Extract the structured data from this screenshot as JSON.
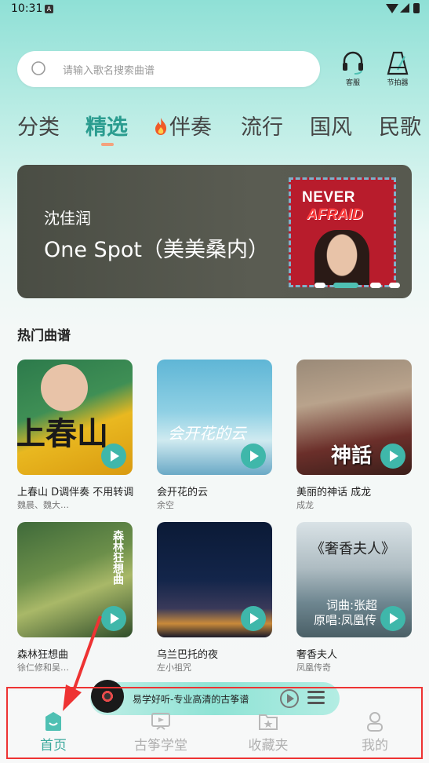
{
  "status_bar": {
    "time": "10:31",
    "sim_icon": "A"
  },
  "search": {
    "placeholder": "请输入歌名搜索曲谱"
  },
  "top_buttons": {
    "service": "客服",
    "metronome": "节拍器"
  },
  "tabs": [
    {
      "label": "分类"
    },
    {
      "label": "精选",
      "active": true
    },
    {
      "label": "伴奏",
      "icon": "fire-icon"
    },
    {
      "label": "流行"
    },
    {
      "label": "国风"
    },
    {
      "label": "民歌"
    }
  ],
  "banner": {
    "artist": "沈佳润",
    "song": "One Spot（美美桑内）",
    "cover_title_1": "NEVER",
    "cover_title_2": "AFRAID",
    "slides_total": 4,
    "slide_active_index": 1
  },
  "hot": {
    "title": "热门曲谱",
    "cards": [
      {
        "name": "上春山 D调伴奏 不用转调",
        "sub": "魏晨、魏大…",
        "overlay": "上春山"
      },
      {
        "name": "会开花的云",
        "sub": "余空",
        "overlay": "会开花的云"
      },
      {
        "name": "美丽的神话 成龙",
        "sub": "成龙",
        "overlay": "神話"
      },
      {
        "name": "森林狂想曲",
        "sub": "徐仁修和吴…",
        "overlay": "森林狂想曲"
      },
      {
        "name": "乌兰巴托的夜",
        "sub": "左小祖咒",
        "overlay": ""
      },
      {
        "name": "奢香夫人",
        "sub": "凤凰传奇",
        "overlay": "《奢香夫人》",
        "overlay_2": "词曲:张超",
        "overlay_3": "原唱:凤凰传"
      }
    ]
  },
  "mini_player": {
    "title": "易学好听-专业高清的古筝谱"
  },
  "nav": [
    {
      "label": "首页",
      "active": true,
      "icon": "home-icon"
    },
    {
      "label": "古筝学堂",
      "icon": "classroom-icon"
    },
    {
      "label": "收藏夹",
      "icon": "favorites-icon"
    },
    {
      "label": "我的",
      "icon": "profile-icon"
    }
  ],
  "colors": {
    "accent": "#3aa89c",
    "tab_underline": "#f4a27d",
    "annotation": "#ee3333"
  }
}
